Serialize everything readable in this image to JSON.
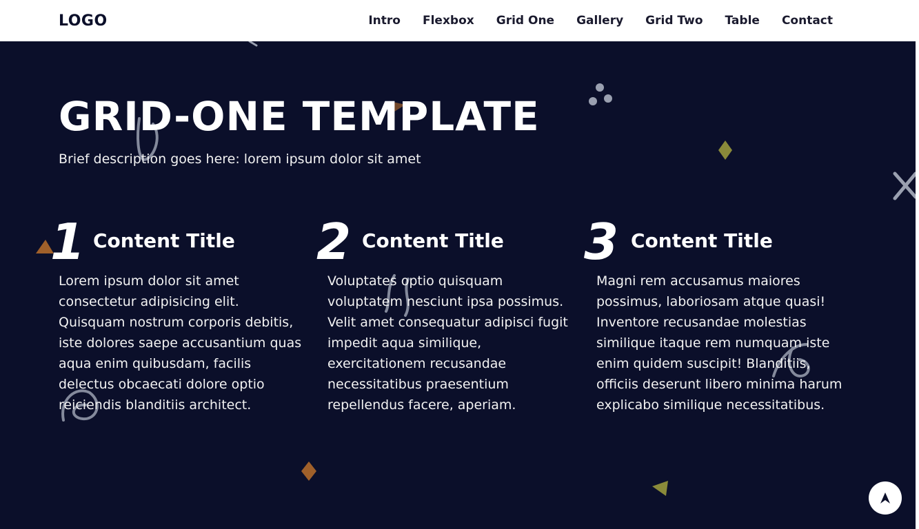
{
  "header": {
    "logo": "LOGO",
    "nav": [
      "Intro",
      "Flexbox",
      "Grid One",
      "Gallery",
      "Grid Two",
      "Table",
      "Contact"
    ]
  },
  "hero": {
    "title": "GRID-ONE TEMPLATE",
    "description": "Brief description goes here: lorem ipsum dolor sit amet"
  },
  "columns": [
    {
      "number": "1",
      "title": "Content Title",
      "text": "Lorem ipsum dolor sit amet consectetur adipisicing elit. Quisquam nostrum corporis debitis, iste dolores saepe accusantium quas aqua enim quibusdam, facilis delectus obcaecati dolore optio reiciendis blanditiis architect."
    },
    {
      "number": "2",
      "title": "Content Title",
      "text": "Voluptates optio quisquam voluptatem nesciunt ipsa possimus. Velit amet consequatur adipisci fugit impedit aqua similique, exercitationem recusandae necessitatibus praesentium repellendus facere, aperiam."
    },
    {
      "number": "3",
      "title": "Content Title",
      "text": "Magni rem accusamus maiores possimus, laboriosam atque quasi! Inventore recusandae molestias similique itaque rem numquam iste enim quidem suscipit! Blanditiis, officiis deserunt libero minima harum explicabo similique necessitatibus."
    }
  ],
  "colors": {
    "background": "#0b0f2a",
    "header_bg": "#ffffff",
    "accent_orange": "#a0602a",
    "accent_olive": "#8a8a3a",
    "squiggle": "#9aa0b0"
  },
  "icons": {
    "back_to_top": "arrow-up-icon"
  }
}
